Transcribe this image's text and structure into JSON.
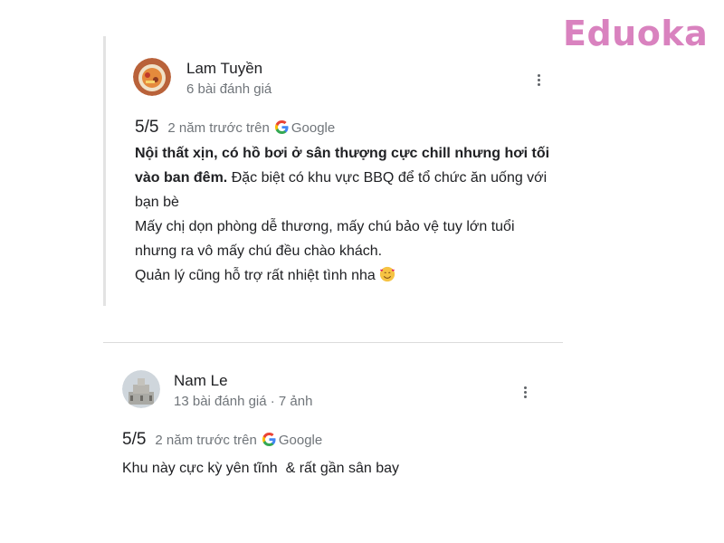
{
  "brand": {
    "text": "Eduoka",
    "color": "#d982bf"
  },
  "reviews": [
    {
      "reviewer": "Lam Tuyền",
      "meta": "6 bài đánh giá",
      "avatar_icon": "food-photo-avatar",
      "rating": "5/5",
      "time": "2 năm trước trên",
      "source": "Google",
      "text_bold": "Nội thất xịn, có hồ bơi ở sân thượng cực chill nhưng hơi tối vào ban đêm.",
      "text_rest": " Đặc biệt có khu vực BBQ để tổ chức ăn uống với bạn bè",
      "line2": "Mấy chị dọn phòng dễ thương, mấy chú bảo vệ tuy lớn tuổi nhưng ra vô mấy chú đều chào khách.",
      "line3": "Quản lý cũng hỗ trợ rất nhiệt tình nha",
      "emoji_icon": "smiling-face-with-hearts-icon"
    },
    {
      "reviewer": "Nam Le",
      "meta": "13 bài đánh giá · 7 ảnh",
      "avatar_icon": "building-photo-avatar",
      "rating": "5/5",
      "time": "2 năm trước trên",
      "source": "Google",
      "text": "Khu này cực kỳ yên tĩnh  & rất gần sân bay"
    }
  ],
  "colors": {
    "google_blue": "#4285f4",
    "google_red": "#ea4335",
    "google_yellow": "#fbbc05",
    "google_green": "#34a853"
  }
}
